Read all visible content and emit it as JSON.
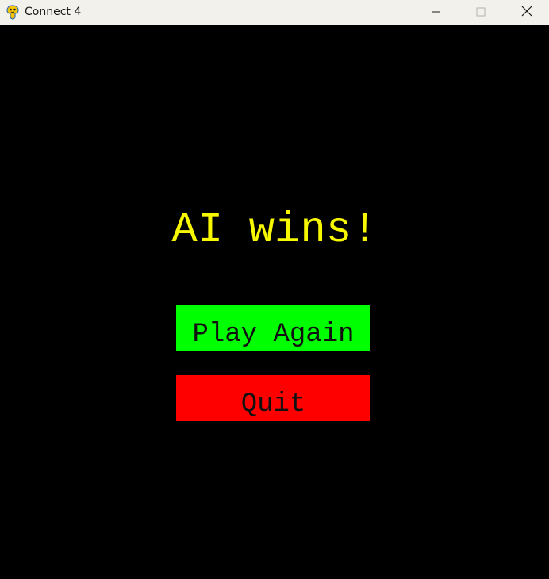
{
  "window": {
    "title": "Connect 4",
    "app_icon": "pygame-snake-icon",
    "controls": {
      "minimize_icon": "minimize-icon",
      "maximize_icon": "maximize-icon",
      "close_icon": "close-icon"
    }
  },
  "game": {
    "result_text": "AI wins!",
    "play_again_label": "Play Again",
    "quit_label": "Quit"
  },
  "colors": {
    "background": "#000000",
    "result_text": "#f7f700",
    "play_again_bg": "#00ff00",
    "quit_bg": "#ff0000",
    "button_text": "#111111",
    "titlebar_bg": "#f3f1ec"
  }
}
